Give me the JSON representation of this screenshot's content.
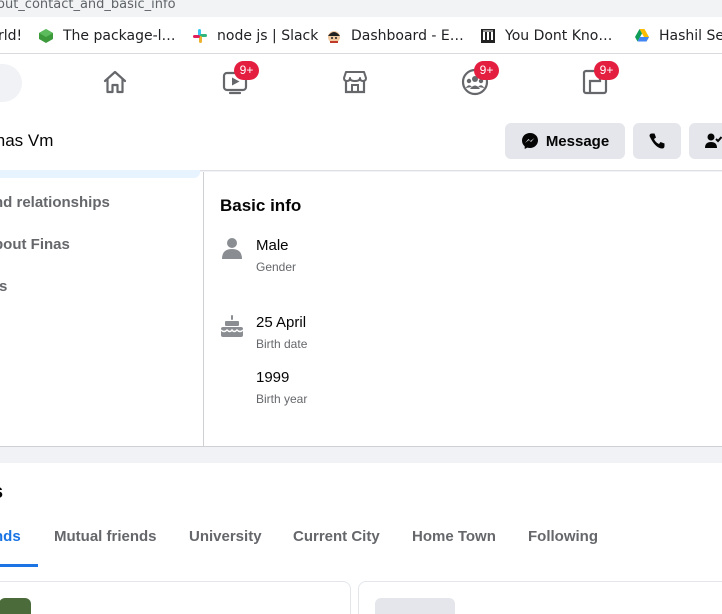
{
  "browser": {
    "url_fragment": "out_contact_and_basic_info",
    "bookmarks": [
      {
        "label": "rld!",
        "icon": "none"
      },
      {
        "label": "The package-l…",
        "icon": "npm-cube-icon"
      },
      {
        "label": "node js | Slack",
        "icon": "slack-icon"
      },
      {
        "label": "Dashboard - E…",
        "icon": "ninja-avatar-icon"
      },
      {
        "label": "You Dont Kno…",
        "icon": "library-icon"
      },
      {
        "label": "Hashil Se",
        "icon": "google-drive-icon"
      }
    ]
  },
  "fb_nav": {
    "items": [
      {
        "name": "home",
        "badge": ""
      },
      {
        "name": "watch",
        "badge": "9+"
      },
      {
        "name": "marketplace",
        "badge": ""
      },
      {
        "name": "groups",
        "badge": "9+"
      },
      {
        "name": "gaming",
        "badge": "9+"
      }
    ]
  },
  "profile": {
    "name": "inas Vm",
    "message_button": "Message"
  },
  "about": {
    "nav": [
      "nd relationships",
      "bout Finas",
      "ts"
    ],
    "section_title": "Basic info",
    "gender": {
      "value": "Male",
      "label": "Gender"
    },
    "birth_date": {
      "value": "25 April",
      "label": "Birth date"
    },
    "birth_year": {
      "value": "1999",
      "label": "Birth year"
    }
  },
  "friends": {
    "title": "s",
    "tabs": [
      "nds",
      "Mutual friends",
      "University",
      "Current City",
      "Home Town",
      "Following"
    ],
    "active_tab": 0
  },
  "colors": {
    "accent": "#1b74e4",
    "badge": "#e41e3f",
    "icon_grey": "#65676b",
    "button_bg": "#e4e6eb"
  }
}
